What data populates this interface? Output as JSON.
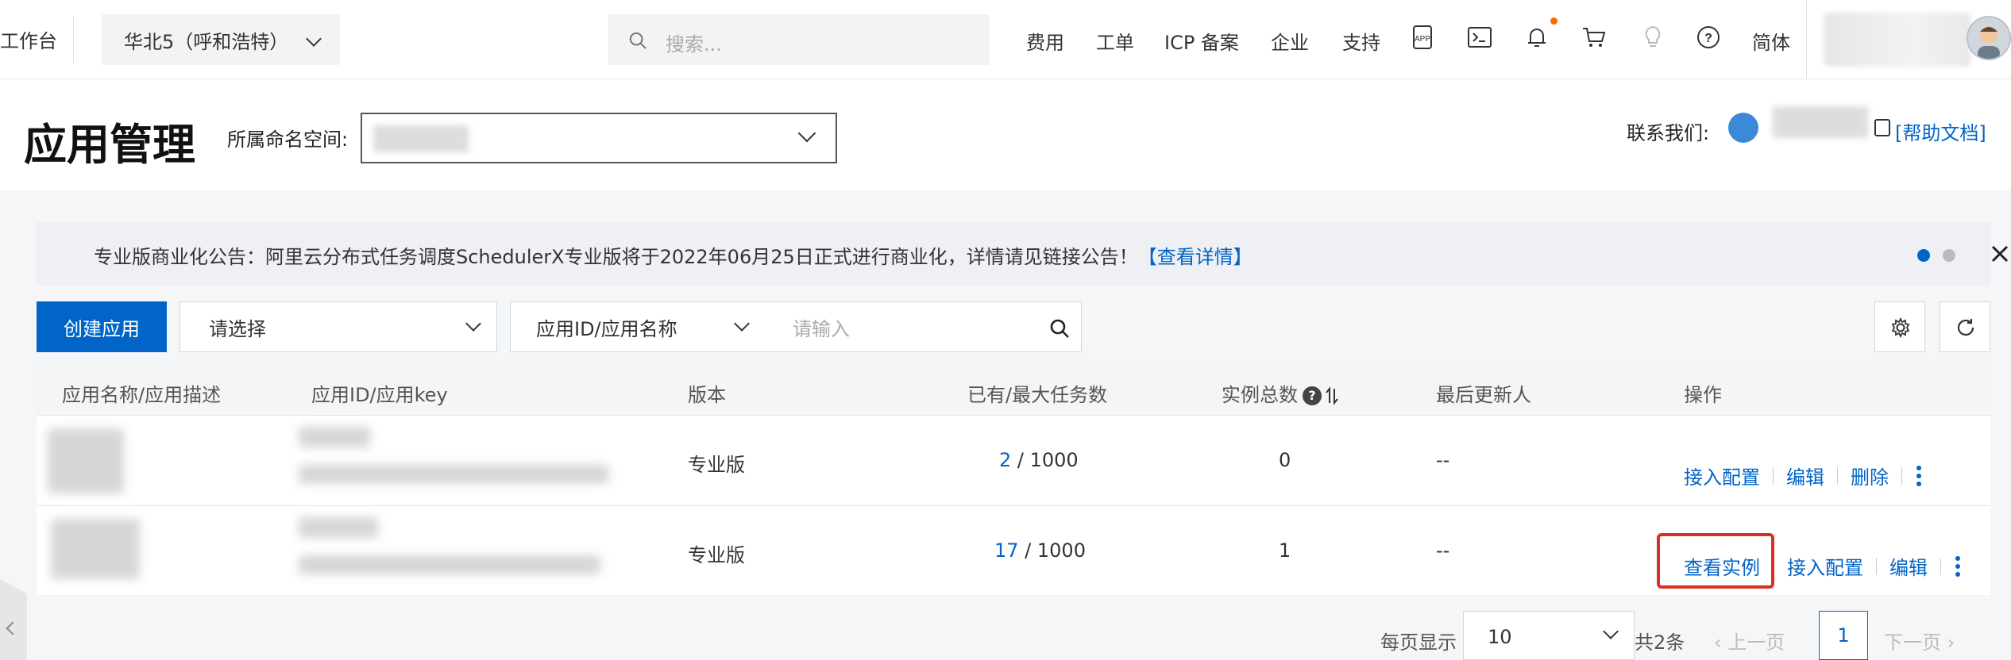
{
  "topbar": {
    "workbench": "工作台",
    "region": "华北5（呼和浩特）",
    "search_placeholder": "搜索...",
    "nav": [
      "费用",
      "工单",
      "ICP 备案",
      "企业",
      "支持"
    ],
    "lang": "简体",
    "icons": [
      "app-icon",
      "terminal-icon",
      "bell-icon",
      "cart-icon",
      "lightbulb-icon",
      "help-icon"
    ]
  },
  "header": {
    "title": "应用管理",
    "namespace_label": "所属命名空间:",
    "contact_label": "联系我们:",
    "help_link": "[帮助文档]"
  },
  "notice": {
    "text": "专业版商业化公告：阿里云分布式任务调度SchedulerX专业版将于2022年06月25日正式进行商业化，详情请见链接公告！",
    "link": "【查看详情】"
  },
  "toolbar": {
    "create": "创建应用",
    "select_placeholder": "请选择",
    "filter_type": "应用ID/应用名称",
    "search_placeholder": "请输入"
  },
  "table": {
    "headers": [
      "应用名称/应用描述",
      "应用ID/应用key",
      "版本",
      "已有/最大任务数",
      "实例总数",
      "最后更新人",
      "操作"
    ],
    "rows": [
      {
        "version": "专业版",
        "tasks_used": "2",
        "tasks_max": " / 1000",
        "instances": "0",
        "updater": "--",
        "ops": [
          "接入配置",
          "编辑",
          "删除"
        ]
      },
      {
        "version": "专业版",
        "tasks_used": "17",
        "tasks_max": " / 1000",
        "instances": "1",
        "updater": "--",
        "ops": [
          "查看实例",
          "接入配置",
          "编辑"
        ]
      }
    ]
  },
  "pagination": {
    "per_page_label": "每页显示",
    "per_page": "10",
    "total": "共2条",
    "prev": "上一页",
    "next": "下一页",
    "current": "1"
  },
  "colors": {
    "accent": "#0064c8",
    "highlight": "#d93025"
  }
}
